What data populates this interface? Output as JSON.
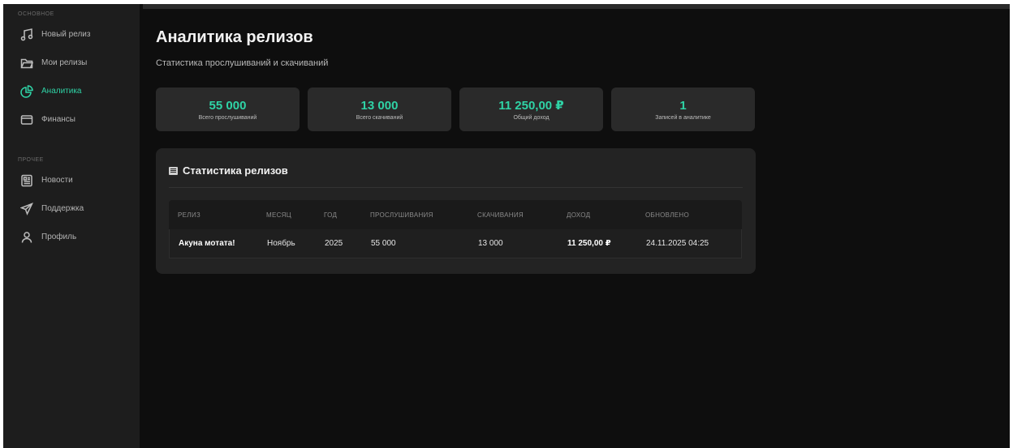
{
  "sidebar": {
    "section_main": "ОСНОВНОЕ",
    "section_other": "ПРОЧЕЕ",
    "items": [
      {
        "label": "Новый релиз",
        "icon": "music-note-icon"
      },
      {
        "label": "Мои релизы",
        "icon": "folder-icon"
      },
      {
        "label": "Аналитика",
        "icon": "pie-chart-icon",
        "active": true
      },
      {
        "label": "Финансы",
        "icon": "wallet-icon"
      },
      {
        "label": "Новости",
        "icon": "newspaper-icon"
      },
      {
        "label": "Поддержка",
        "icon": "send-icon"
      },
      {
        "label": "Профиль",
        "icon": "user-icon"
      }
    ]
  },
  "header": {
    "title": "Аналитика релизов",
    "subtitle": "Статистика прослушиваний и скачиваний"
  },
  "stats": [
    {
      "value": "55 000",
      "label": "Всего прослушиваний"
    },
    {
      "value": "13 000",
      "label": "Всего скачиваний"
    },
    {
      "value": "11 250,00 ₽",
      "label": "Общий доход"
    },
    {
      "value": "1",
      "label": "Записей в аналитике"
    }
  ],
  "table_card": {
    "title": "Статистика релизов",
    "columns": [
      "РЕЛИЗ",
      "МЕСЯЦ",
      "ГОД",
      "ПРОСЛУШИВАНИЯ",
      "СКАЧИВАНИЯ",
      "ДОХОД",
      "ОБНОВЛЕНО"
    ],
    "rows": [
      [
        "Акуна мотата!",
        "Ноябрь",
        "2025",
        "55 000",
        "13 000",
        "11 250,00 ₽",
        "24.11.2025 04:25"
      ]
    ]
  },
  "colors": {
    "accent": "#2fd3a6",
    "background": "#0e0e0e",
    "sidebar": "#1d1d1d",
    "card": "#2a2a2a"
  }
}
